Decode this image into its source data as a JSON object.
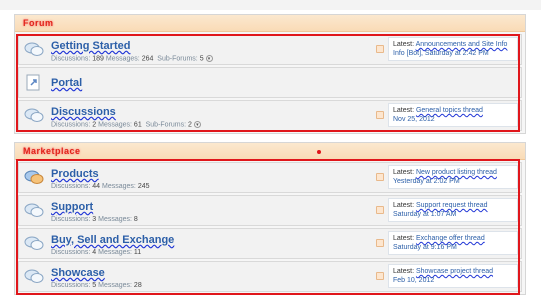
{
  "categories": [
    {
      "title": "Forum",
      "nodes": [
        {
          "title": "Getting Started",
          "stats_label": "Discussions:",
          "discussions": "189",
          "messages_label": "Messages:",
          "messages": "264",
          "subforums_label": "Sub-Forums:",
          "subforums": "5",
          "latest_label": "Latest:",
          "latest_title": "Announcements and Site Info",
          "latest_suffix": "Info [Bot], Saturday at 2:42 PM",
          "icon": "chat-bubbles-icon"
        },
        {
          "title": "Portal",
          "stats_label": "",
          "discussions": "",
          "messages_label": "",
          "messages": "",
          "subforums_label": "",
          "subforums": "",
          "latest_label": "",
          "latest_title": "",
          "latest_suffix": "",
          "icon": "link-forum-icon"
        },
        {
          "title": "Discussions",
          "stats_label": "Discussions:",
          "discussions": "2",
          "messages_label": "Messages:",
          "messages": "61",
          "subforums_label": "Sub-Forums:",
          "subforums": "2",
          "latest_label": "Latest:",
          "latest_title": "General topics thread",
          "latest_suffix": "Nov 25, 2012",
          "icon": "chat-bubbles-icon"
        }
      ]
    },
    {
      "title": "Marketplace",
      "nodes": [
        {
          "title": "Products",
          "stats_label": "Discussions:",
          "discussions": "44",
          "messages_label": "Messages:",
          "messages": "245",
          "latest_label": "Latest:",
          "latest_title": "New product listing thread",
          "latest_suffix": "Yesterday at 2:02 PM",
          "icon": "chat-bubbles-unread-icon"
        },
        {
          "title": "Support",
          "stats_label": "Discussions:",
          "discussions": "3",
          "messages_label": "Messages:",
          "messages": "8",
          "latest_label": "Latest:",
          "latest_title": "Support request thread",
          "latest_suffix": "Saturday at 1:07 AM",
          "icon": "chat-bubbles-icon"
        },
        {
          "title": "Buy, Sell and Exchange",
          "stats_label": "Discussions:",
          "discussions": "4",
          "messages_label": "Messages:",
          "messages": "11",
          "latest_label": "Latest:",
          "latest_title": "Exchange offer thread",
          "latest_suffix": "Saturday at 9:16 PM",
          "icon": "chat-bubbles-icon"
        },
        {
          "title": "Showcase",
          "stats_label": "Discussions:",
          "discussions": "5",
          "messages_label": "Messages:",
          "messages": "28",
          "latest_label": "Latest:",
          "latest_title": "Showcase project thread",
          "latest_suffix": "Feb 10, 2012",
          "icon": "chat-bubbles-icon"
        }
      ]
    }
  ],
  "colors": {
    "accent_red": "#e0161b",
    "header_orange": "#f9dbb6",
    "link_blue": "#2c5fa8"
  }
}
